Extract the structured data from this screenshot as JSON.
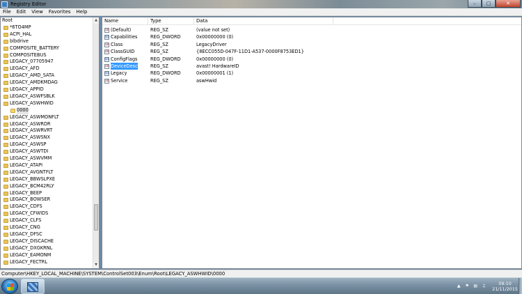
{
  "window": {
    "title": "Registry Editor"
  },
  "menu": [
    "File",
    "Edit",
    "View",
    "Favorites",
    "Help"
  ],
  "tree": {
    "root": "Root",
    "items": [
      {
        "label": "*6TO4MP",
        "level": 1
      },
      {
        "label": "ACPI_HAL",
        "level": 1
      },
      {
        "label": "blbdrive",
        "level": 1
      },
      {
        "label": "COMPOSITE_BATTERY",
        "level": 1
      },
      {
        "label": "COMPOSITEBUS",
        "level": 1
      },
      {
        "label": "LEGACY_07705947",
        "level": 1
      },
      {
        "label": "LEGACY_AFD",
        "level": 1
      },
      {
        "label": "LEGACY_AMD_SATA",
        "level": 1
      },
      {
        "label": "LEGACY_AMDKMDAG",
        "level": 1
      },
      {
        "label": "LEGACY_APPID",
        "level": 1
      },
      {
        "label": "LEGACY_ASWFSBLK",
        "level": 1
      },
      {
        "label": "LEGACY_ASWHWID",
        "level": 1
      },
      {
        "label": "0000",
        "level": 2,
        "selected": true
      },
      {
        "label": "LEGACY_ASWMONFLT",
        "level": 1
      },
      {
        "label": "LEGACY_ASWRDR",
        "level": 1
      },
      {
        "label": "LEGACY_ASWRVRT",
        "level": 1
      },
      {
        "label": "LEGACY_ASWSNX",
        "level": 1
      },
      {
        "label": "LEGACY_ASWSP",
        "level": 1
      },
      {
        "label": "LEGACY_ASWTDI",
        "level": 1
      },
      {
        "label": "LEGACY_ASWVMM",
        "level": 1
      },
      {
        "label": "LEGACY_ATAPI",
        "level": 1
      },
      {
        "label": "LEGACY_AVGNTFLT",
        "level": 1
      },
      {
        "label": "LEGACY_BBWSLPXE",
        "level": 1
      },
      {
        "label": "LEGACY_BCM42RLY",
        "level": 1
      },
      {
        "label": "LEGACY_BEEP",
        "level": 1
      },
      {
        "label": "LEGACY_BOWSER",
        "level": 1
      },
      {
        "label": "LEGACY_CDFS",
        "level": 1
      },
      {
        "label": "LEGACY_CFWIDS",
        "level": 1
      },
      {
        "label": "LEGACY_CLFS",
        "level": 1
      },
      {
        "label": "LEGACY_CNG",
        "level": 1
      },
      {
        "label": "LEGACY_DFSC",
        "level": 1
      },
      {
        "label": "LEGACY_DISCACHE",
        "level": 1
      },
      {
        "label": "LEGACY_DXGKRNL",
        "level": 1
      },
      {
        "label": "LEGACY_EAMONM",
        "level": 1
      },
      {
        "label": "LEGACY_FECTRL",
        "level": 1
      }
    ]
  },
  "values": {
    "headers": {
      "name": "Name",
      "type": "Type",
      "data": "Data"
    },
    "rows": [
      {
        "name": "(Default)",
        "type": "REG_SZ",
        "data": "(value not set)",
        "icon": "string-value-icon"
      },
      {
        "name": "Capabilities",
        "type": "REG_DWORD",
        "data": "0x00000000 (0)",
        "icon": "dword-value-icon"
      },
      {
        "name": "Class",
        "type": "REG_SZ",
        "data": "LegacyDriver",
        "icon": "string-value-icon"
      },
      {
        "name": "ClassGUID",
        "type": "REG_SZ",
        "data": "{8ECC055D-047F-11D1-A537-0000F8753ED1}",
        "icon": "string-value-icon"
      },
      {
        "name": "ConfigFlags",
        "type": "REG_DWORD",
        "data": "0x00000000 (0)",
        "icon": "dword-value-icon"
      },
      {
        "name": "DeviceDesc",
        "type": "REG_SZ",
        "data": "avast! HardwareID",
        "icon": "string-value-icon",
        "selected": true
      },
      {
        "name": "Legacy",
        "type": "REG_DWORD",
        "data": "0x00000001 (1)",
        "icon": "dword-value-icon"
      },
      {
        "name": "Service",
        "type": "REG_SZ",
        "data": "aswHwid",
        "icon": "string-value-icon"
      }
    ]
  },
  "status": {
    "path": "Computer\\HKEY_LOCAL_MACHINE\\SYSTEM\\ControlSet003\\Enum\\Root\\LEGACY_ASWHWID\\0000"
  },
  "taskbar": {
    "time": "09:10",
    "date": "21/11/2015"
  },
  "colors": {
    "selection": "#3399ff",
    "folder": "#e9c45a"
  }
}
